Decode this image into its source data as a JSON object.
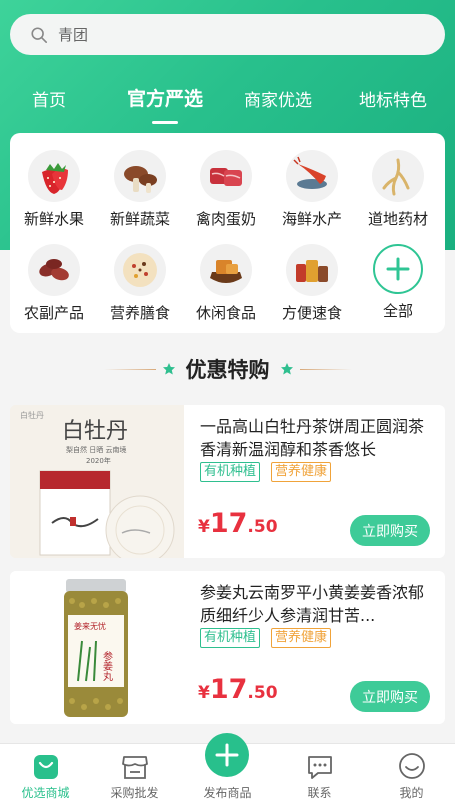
{
  "search": {
    "placeholder": "青团"
  },
  "top_tabs": [
    {
      "label": "首页"
    },
    {
      "label": "官方严选"
    },
    {
      "label": "商家优选"
    },
    {
      "label": "地标特色"
    }
  ],
  "categories": [
    {
      "label": "新鲜水果",
      "icon": "strawberry-icon"
    },
    {
      "label": "新鲜蔬菜",
      "icon": "mushroom-icon"
    },
    {
      "label": "禽肉蛋奶",
      "icon": "meat-icon"
    },
    {
      "label": "海鲜水产",
      "icon": "lobster-icon"
    },
    {
      "label": "道地药材",
      "icon": "ginseng-icon"
    },
    {
      "label": "农副产品",
      "icon": "dates-icon"
    },
    {
      "label": "营养膳食",
      "icon": "porridge-icon"
    },
    {
      "label": "休闲食品",
      "icon": "snacks-icon"
    },
    {
      "label": "方便速食",
      "icon": "instant-food-icon"
    },
    {
      "label": "全部",
      "icon": "plus-icon"
    }
  ],
  "section": {
    "title": "优惠特购"
  },
  "products": [
    {
      "title": "一品高山白牡丹茶饼周正圆润茶香清新温润醇和茶香悠长",
      "tags": [
        "有机种植",
        "营养健康"
      ],
      "price_currency": "¥",
      "price_int": "17",
      "price_dec": ".50",
      "buy_label": "立即购买",
      "image": {
        "box_title": "白牡丹",
        "box_subtitle": "梨自然 日晒 云南境",
        "box_year": "2020年",
        "brand": "白牡丹"
      }
    },
    {
      "title": "参姜丸云南罗平小黄姜姜香浓郁质细纤少人参清润甘苦...",
      "tags": [
        "有机种植",
        "营养健康"
      ],
      "price_currency": "¥",
      "price_int": "17",
      "price_dec": ".50",
      "buy_label": "立即购买",
      "image": {
        "jar_brand": "姜来无忧",
        "jar_label": "参姜丸"
      }
    }
  ],
  "tabbar": [
    {
      "label": "优选商城",
      "icon": "shopping-bag-icon",
      "active": true
    },
    {
      "label": "采购批发",
      "icon": "store-icon"
    },
    {
      "label": "发布商品",
      "icon": "add-circle-icon"
    },
    {
      "label": "联系",
      "icon": "chat-icon"
    },
    {
      "label": "我的",
      "icon": "smile-face-icon"
    }
  ],
  "colors": {
    "brand": "#28c08c",
    "price": "#e8313f",
    "tag_orange": "#f0a33a"
  }
}
